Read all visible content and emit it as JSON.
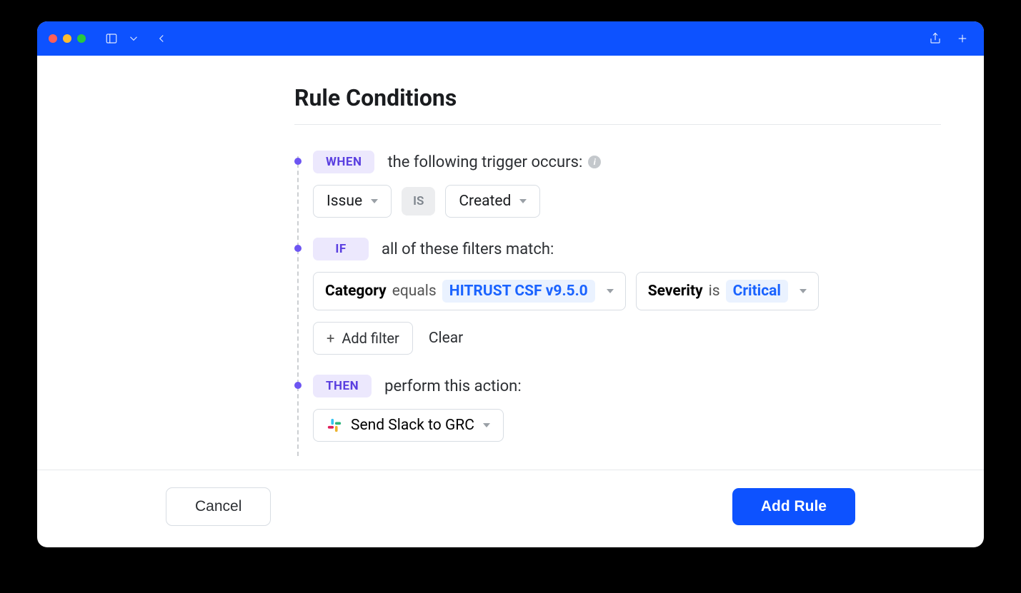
{
  "page_title": "Rule Conditions",
  "when": {
    "chip": "WHEN",
    "desc": "the following trigger occurs:",
    "subject": "Issue",
    "operator": "IS",
    "verb": "Created"
  },
  "if": {
    "chip": "IF",
    "desc": "all of these filters match:",
    "filters": [
      {
        "field": "Category",
        "op": "equals",
        "value": "HITRUST CSF v9.5.0"
      },
      {
        "field": "Severity",
        "op": "is",
        "value": "Critical"
      }
    ],
    "add_filter_label": "Add filter",
    "clear_label": "Clear"
  },
  "then": {
    "chip": "THEN",
    "desc": "perform this action:",
    "action_label": "Send Slack to GRC"
  },
  "footer": {
    "cancel": "Cancel",
    "submit": "Add Rule"
  }
}
